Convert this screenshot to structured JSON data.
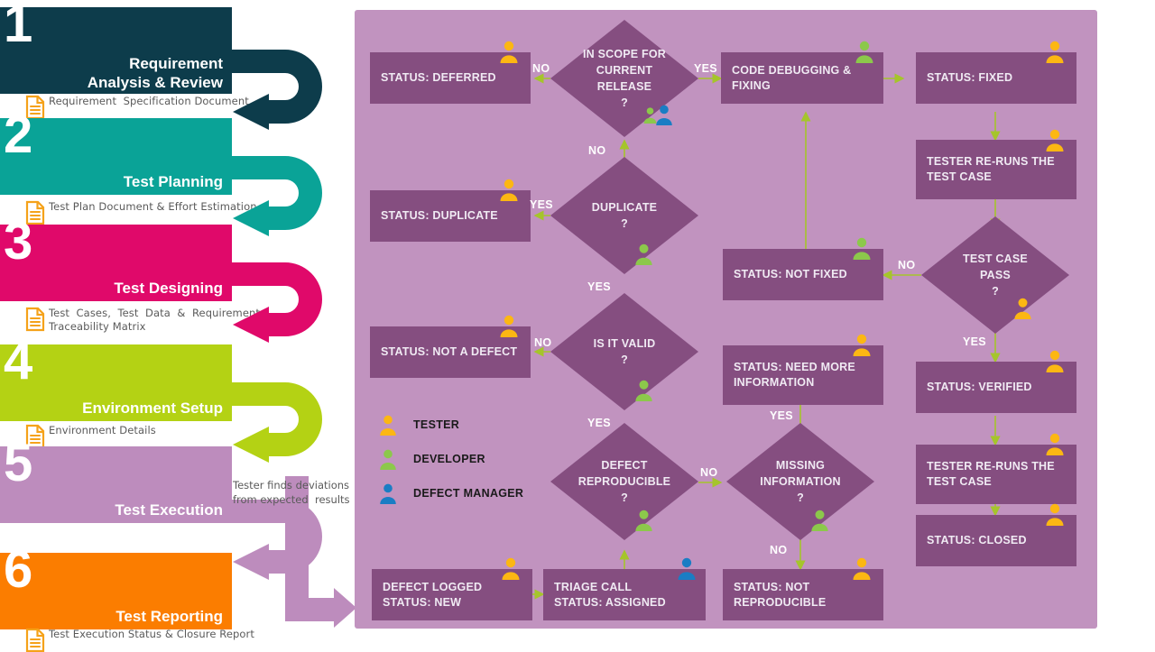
{
  "process": {
    "steps": [
      {
        "num": "1",
        "title": "Requirement\nAnalysis & Review",
        "doc": "Requirement  Specification Document",
        "color": "#0d3c4b"
      },
      {
        "num": "2",
        "title": "Test Planning",
        "doc": "Test Plan Document & Effort Estimation",
        "color": "#0aa397"
      },
      {
        "num": "3",
        "title": "Test Designing",
        "doc": "Test  Cases,  Test  Data  &  Requirements\nTraceability Matrix",
        "color": "#e0096a"
      },
      {
        "num": "4",
        "title": "Environment  Setup",
        "doc": "Environment Details",
        "color": "#b4d214"
      },
      {
        "num": "5",
        "title": "Test Execution",
        "doc": "",
        "color": "#bd8cbd"
      },
      {
        "num": "6",
        "title": "Test Reporting",
        "doc": "Test Execution Status & Closure Report",
        "color": "#fb7d00"
      }
    ],
    "deviation_note": "Tester finds deviations\nfrom expected  results"
  },
  "panel": {
    "background": "#c193bf",
    "node_color": "#854e80",
    "arrow_color": "#a5c52b",
    "nodes": {
      "deferred": "STATUS: DEFERRED",
      "in_scope": "IN SCOPE FOR\nCURRENT\nRELEASE\n?",
      "code_debug": "CODE DEBUGGING &\nFIXING",
      "fixed": "STATUS: FIXED",
      "rerun_top": "TESTER RE-RUNS THE\nTEST CASE",
      "duplicate_status": "STATUS: DUPLICATE",
      "duplicate_q": "DUPLICATE\n?",
      "not_fixed": "STATUS: NOT FIXED",
      "test_case_pass": "TEST CASE\nPASS\n?",
      "not_a_defect": "STATUS: NOT A DEFECT",
      "is_it_valid": "IS IT VALID\n?",
      "need_more_info": "STATUS: NEED MORE\nINFORMATION",
      "verified": "STATUS: VERIFIED",
      "defect_reproducible": "DEFECT\nREPRODUCIBLE\n?",
      "missing_information": "MISSING\nINFORMATION\n?",
      "rerun_bottom": "TESTER RE-RUNS THE\nTEST CASE",
      "defect_logged": "DEFECT LOGGED\nSTATUS: NEW",
      "triage_call": "TRIAGE CALL\nSTATUS: ASSIGNED",
      "not_reproducible": "STATUS: NOT\nREPRODUCIBLE",
      "closed": "STATUS: CLOSED"
    },
    "edge_labels": {
      "in_scope_no_left": "NO",
      "in_scope_yes": "YES",
      "in_scope_no_down": "NO",
      "duplicate_yes_left": "YES",
      "duplicate_yes_down": "YES",
      "valid_no": "NO",
      "valid_yes": "YES",
      "pass_no": "NO",
      "pass_yes": "YES",
      "reproducible_no": "NO",
      "missing_yes": "YES",
      "missing_no": "NO"
    },
    "legend": [
      {
        "role": "TESTER",
        "color": "#fcb713"
      },
      {
        "role": "DEVELOPER",
        "color": "#8cc84b"
      },
      {
        "role": "DEFECT MANAGER",
        "color": "#1a7dc4"
      }
    ]
  }
}
